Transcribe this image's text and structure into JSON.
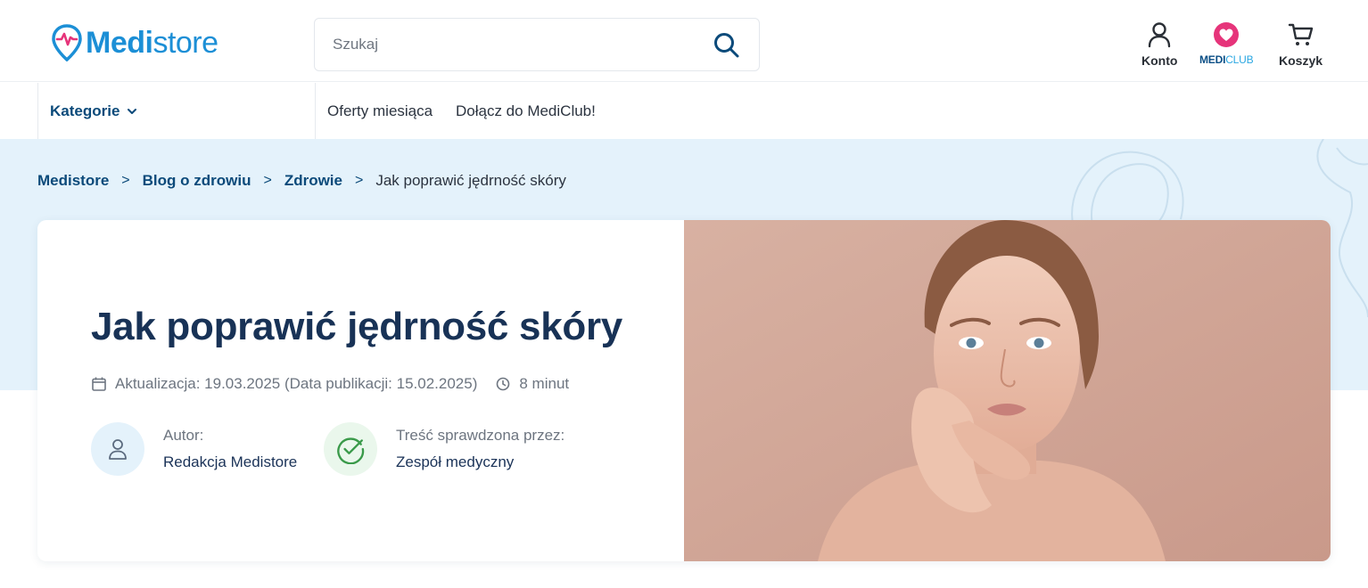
{
  "header": {
    "logo": {
      "medi": "Medi",
      "store": "store"
    },
    "search": {
      "placeholder": "Szukaj"
    },
    "actions": {
      "account_label": "Konto",
      "mediclub_a": "MEDI",
      "mediclub_b": "CLUB",
      "cart_label": "Koszyk"
    }
  },
  "nav": {
    "categories_label": "Kategorie",
    "links": [
      "Oferty miesiąca",
      "Dołącz do MediClub!"
    ]
  },
  "breadcrumb": {
    "items": [
      "Medistore",
      "Blog o zdrowiu",
      "Zdrowie"
    ],
    "separator": ">",
    "current": "Jak poprawić jędrność skóry"
  },
  "article": {
    "title": "Jak poprawić jędrność skóry",
    "dates": "Aktualizacja: 19.03.2025 (Data publikacji: 15.02.2025)",
    "read_time": "8 minut",
    "author": {
      "caption": "Autor:",
      "name": "Redakcja Medistore"
    },
    "reviewer": {
      "caption": "Treść sprawdzona przez:",
      "name": "Zespół medyczny"
    }
  },
  "colors": {
    "brand": "#1c8fd6",
    "brand_dark": "#0b4a7a",
    "heart": "#e6347a",
    "band": "#e4f2fb",
    "check": "#3a9a4a",
    "photo_bg": "#d3a999"
  },
  "icons": [
    "location-pulse-icon",
    "search-icon",
    "user-icon",
    "heart-icon",
    "cart-icon",
    "chevron-down-icon",
    "calendar-icon",
    "clock-icon",
    "check-circle-icon"
  ]
}
